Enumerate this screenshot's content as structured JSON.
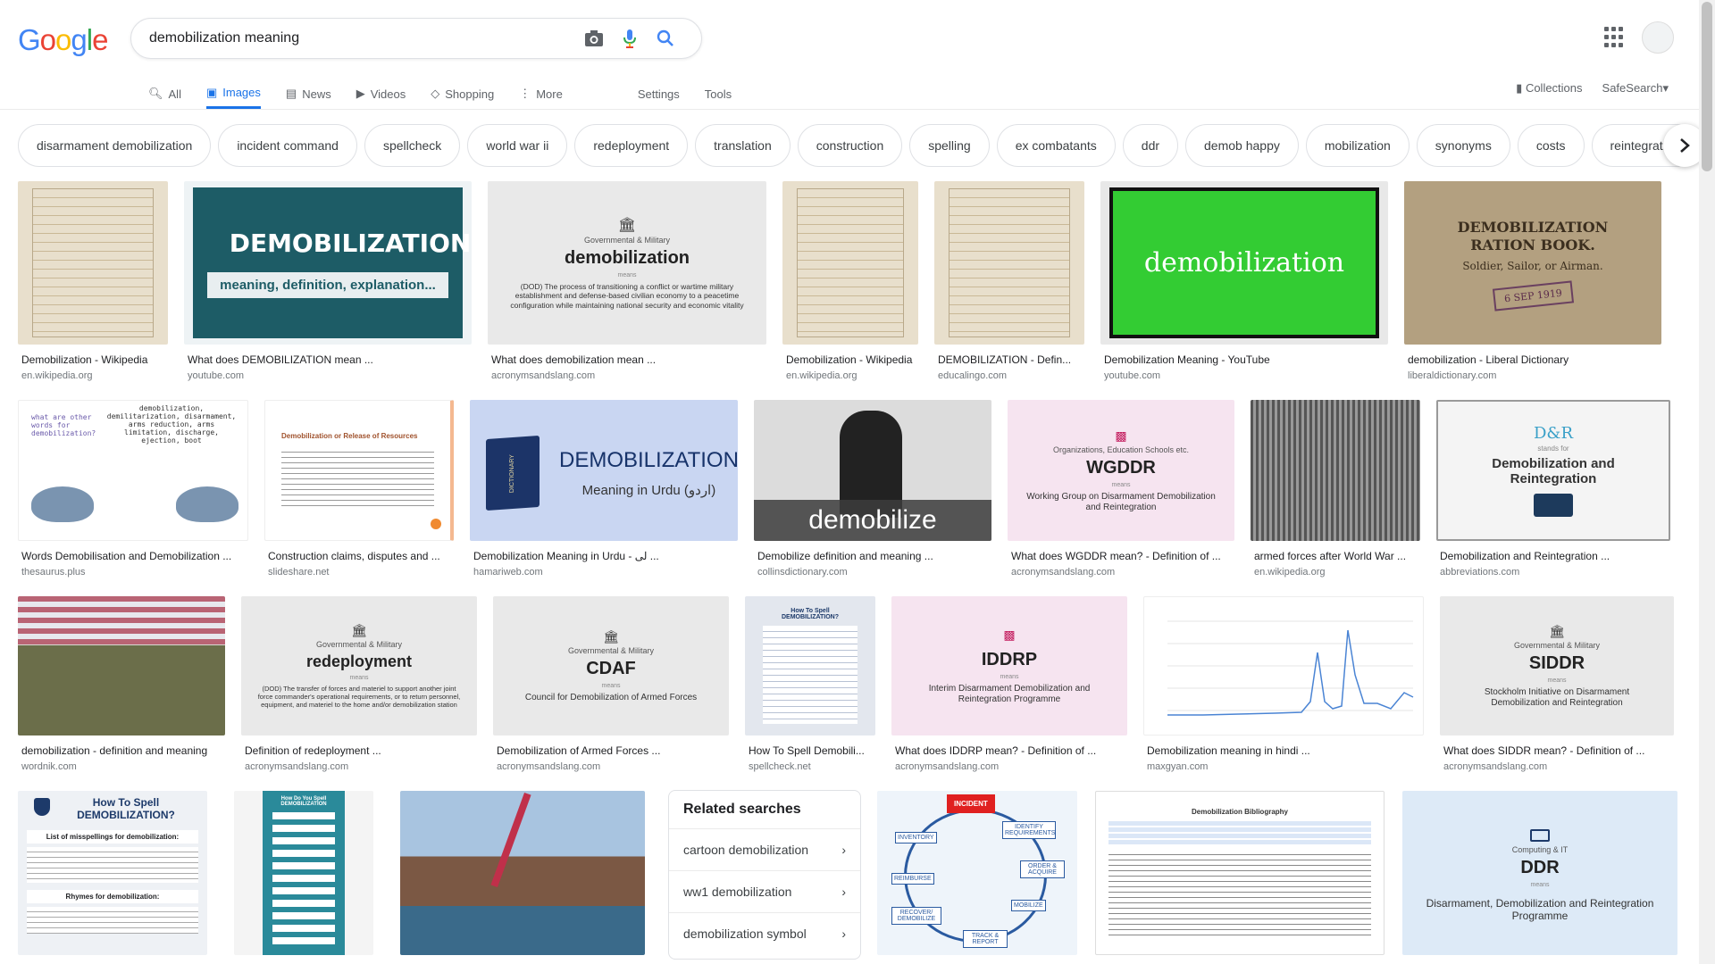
{
  "logo": [
    "G",
    "o",
    "o",
    "g",
    "l",
    "e"
  ],
  "search": {
    "query": "demobilization meaning"
  },
  "nav": {
    "tabs": [
      {
        "label": "All",
        "icon": "search-icon"
      },
      {
        "label": "Images",
        "icon": "image-icon"
      },
      {
        "label": "News",
        "icon": "news-icon"
      },
      {
        "label": "Videos",
        "icon": "video-icon"
      },
      {
        "label": "Shopping",
        "icon": "tag-icon"
      },
      {
        "label": "More",
        "icon": "more-vert-icon"
      }
    ],
    "settings": "Settings",
    "tools": "Tools",
    "collections": "Collections",
    "safesearch": "SafeSearch"
  },
  "chips": [
    "disarmament demobilization",
    "incident command",
    "spellcheck",
    "world war ii",
    "redeployment",
    "translation",
    "construction",
    "spelling",
    "ex combatants",
    "ddr",
    "demob happy",
    "mobilization",
    "synonyms",
    "costs",
    "reintegration"
  ],
  "results": {
    "row1": [
      {
        "caption": "Demobilization - Wikipedia",
        "source": "en.wikipedia.org"
      },
      {
        "caption": "What does DEMOBILIZATION mean ...",
        "source": "youtube.com",
        "title": "DEMOBILIZATION",
        "sub": "meaning, definition, explanation..."
      },
      {
        "caption": "What does demobilization mean ...",
        "source": "acronymsandslang.com",
        "kicker": "Governmental & Military",
        "word": "demobilization",
        "means": "means",
        "def": "(DOD) The process of transitioning a conflict or wartime military establishment and defense-based civilian economy to a peacetime configuration while maintaining national security and economic vitality"
      },
      {
        "caption": "Demobilization - Wikipedia",
        "source": "en.wikipedia.org"
      },
      {
        "caption": "DEMOBILIZATION - Defin...",
        "source": "educalingo.com"
      },
      {
        "caption": "Demobilization Meaning - YouTube",
        "source": "youtube.com",
        "title": "demobilization"
      },
      {
        "caption": "demobilization - Liberal Dictionary",
        "source": "liberaldictionary.com",
        "title": "DEMOBILIZATION RATION BOOK.",
        "sub": "Soldier, Sailor, or Airman.",
        "stamp": "6 SEP 1919"
      }
    ],
    "row2": [
      {
        "caption": "Words Demobilisation and Demobilization ...",
        "source": "thesaurus.plus",
        "bubble": "what are other words for demobilization?",
        "list": "demobilization, demilitarization, disarmament, arms reduction, arms limitation, discharge, ejection, boot"
      },
      {
        "caption": "Construction claims, disputes and ...",
        "source": "slideshare.net",
        "title": "Demobilization or Release of Resources"
      },
      {
        "caption": "Demobilization Meaning in Urdu - لی ...",
        "source": "hamariweb.com",
        "title": "DEMOBILIZATION",
        "sub": "Meaning in Urdu (اردو)",
        "book": "DICTIONARY"
      },
      {
        "caption": "Demobilize definition and meaning ...",
        "source": "collinsdictionary.com",
        "title": "demobilize"
      },
      {
        "caption": "What does WGDDR mean? - Definition of ...",
        "source": "acronymsandslang.com",
        "kicker": "Organizations, Education Schools etc.",
        "word": "WGDDR",
        "means": "means",
        "def": "Working Group on Disarmament Demobilization and Reintegration"
      },
      {
        "caption": "armed forces after World War ...",
        "source": "en.wikipedia.org"
      },
      {
        "caption": "Demobilization and Reintegration ...",
        "source": "abbreviations.com",
        "logo": "D&R",
        "means": "stands for",
        "def": "Demobilization and Reintegration"
      }
    ],
    "row3": [
      {
        "caption": "demobilization - definition and meaning",
        "source": "wordnik.com"
      },
      {
        "caption": "Definition of redeployment ...",
        "source": "acronymsandslang.com",
        "kicker": "Governmental & Military",
        "word": "redeployment",
        "means": "means",
        "def": "(DOD) The transfer of forces and materiel to support another joint force commander's operational requirements, or to return personnel, equipment, and materiel to the home and/or demobilization station"
      },
      {
        "caption": "Demobilization of Armed Forces ...",
        "source": "acronymsandslang.com",
        "kicker": "Governmental & Military",
        "word": "CDAF",
        "means": "means",
        "def": "Council for Demobilization of Armed Forces"
      },
      {
        "caption": "How To Spell Demobili...",
        "source": "spellcheck.net",
        "title": "How To Spell DEMOBILIZATION?"
      },
      {
        "caption": "What does IDDRP mean? - Definition of ...",
        "source": "acronymsandslang.com",
        "word": "IDDRP",
        "means": "means",
        "def": "Interim Disarmament Demobilization and Reintegration Programme"
      },
      {
        "caption": "Demobilization meaning in hindi ...",
        "source": "maxgyan.com"
      },
      {
        "caption": "What does SIDDR mean? - Definition of ...",
        "source": "acronymsandslang.com",
        "kicker": "Governmental & Military",
        "word": "SIDDR",
        "means": "means",
        "def": "Stockholm Initiative on Disarmament Demobilization and Reintegration"
      }
    ],
    "row4": [
      {
        "title": "How To Spell DEMOBILIZATION?",
        "sub": "List of misspellings for demobilization:",
        "sub2": "Rhymes for demobilization:"
      },
      {
        "title": "How Do You Spell DEMOBILIZATION"
      },
      {},
      {
        "labels": [
          "INCIDENT",
          "IDENTIFY REQUIREMENTS",
          "ORDER & ACQUIRE",
          "MOBILIZE",
          "TRACK & REPORT",
          "RECOVER/ DEMOBILIZE",
          "REIMBURSE",
          "INVENTORY"
        ]
      },
      {
        "title": "Demobilization Bibliography"
      },
      {
        "kicker": "Computing & IT",
        "word": "DDR",
        "means": "means",
        "def": "Disarmament, Demobilization and Reintegration Programme"
      }
    ]
  },
  "related": {
    "title": "Related searches",
    "items": [
      "cartoon demobilization",
      "ww1 demobilization",
      "demobilization symbol"
    ]
  },
  "colors": {
    "accent": "#1a73e8",
    "green": "#33cc33",
    "teal": "#1d5c66"
  }
}
